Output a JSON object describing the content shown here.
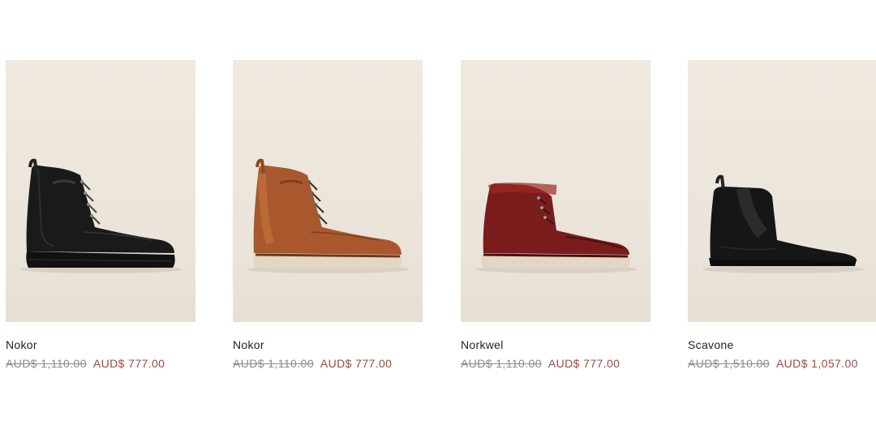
{
  "products": [
    {
      "name": "Nokor",
      "original_price": "AUD$ 1,110.00",
      "sale_price": "AUD$ 777.00",
      "image_icon": "black-leather-boot-icon",
      "colors": {
        "upper": "#1a1a1a",
        "upper_shade": "#2e2e2e",
        "sole": "#111111",
        "welt": "#1f1f1f"
      }
    },
    {
      "name": "Nokor",
      "original_price": "AUD$ 1,110.00",
      "sale_price": "AUD$ 777.00",
      "image_icon": "brown-leather-boot-icon",
      "colors": {
        "upper": "#a8582c",
        "upper_shade": "#c8753f",
        "sole": "#e3d6c2",
        "welt": "#6b3a1c"
      }
    },
    {
      "name": "Norkwel",
      "original_price": "AUD$ 1,110.00",
      "sale_price": "AUD$ 777.00",
      "image_icon": "burgundy-leather-boot-icon",
      "colors": {
        "upper": "#7a1c1c",
        "upper_shade": "#9a2a26",
        "sole": "#e3d6c2",
        "welt": "#4a1010"
      }
    },
    {
      "name": "Scavone",
      "original_price": "AUD$ 1,510.00",
      "sale_price": "AUD$ 1,057.00",
      "image_icon": "black-chelsea-boot-icon",
      "colors": {
        "upper": "#161616",
        "upper_shade": "#2b2b2b",
        "sole": "#0d0d0d",
        "welt": "#0d0d0d"
      }
    }
  ]
}
